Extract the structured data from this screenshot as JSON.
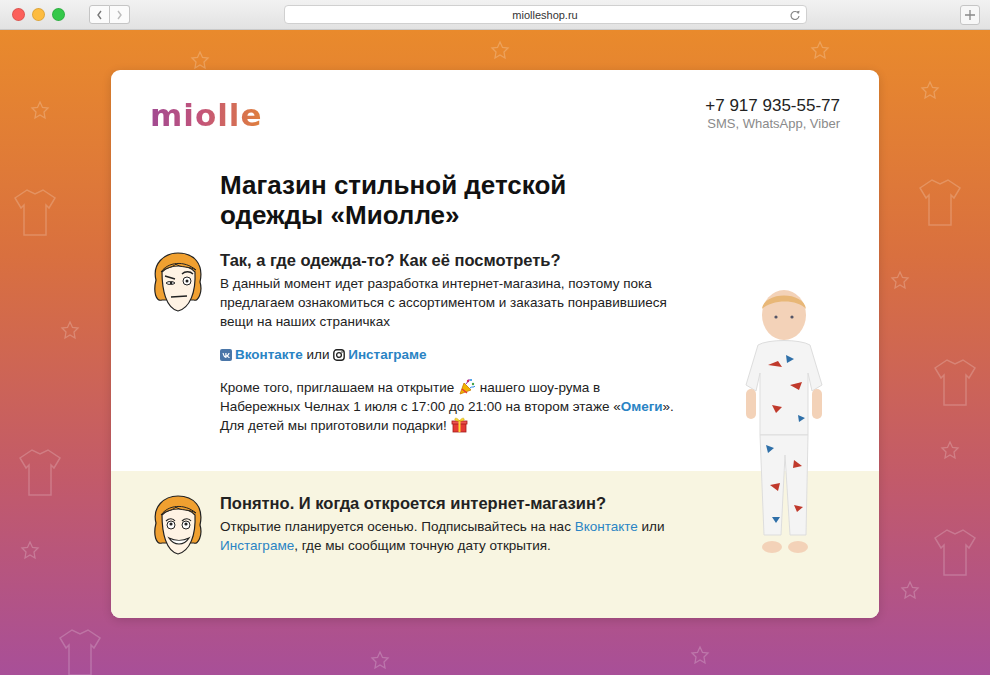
{
  "browser": {
    "url": "miolleshop.ru"
  },
  "header": {
    "logo": "miolle",
    "phone": "+7 917 935-55-77",
    "channels": "SMS, WhatsApp, Viber"
  },
  "title": "Магазин стильной детской одежды «Миолле»",
  "faq": [
    {
      "kind": "skeptical",
      "question": "Так, а где одежда-то? Как её посмотреть?",
      "paragraphs": [
        [
          {
            "kind": "text",
            "text": "В данный момент идет разработка интернет-магазина, поэтому пока предлагаем ознакомиться с ассортиментом и заказать понравившиеся вещи на наших страничках"
          }
        ],
        [
          {
            "kind": "vk",
            "text": "Вконтакте"
          },
          {
            "kind": "text",
            "text": " или "
          },
          {
            "kind": "instagram",
            "text": "Инстаграме"
          }
        ],
        [
          {
            "kind": "text",
            "text": "Кроме того, приглашаем на открытие "
          },
          {
            "kind": "party"
          },
          {
            "kind": "text",
            "text": " нашего шоу-рума в Набережных Челнах 1 июля с 17:00 до 21:00 на втором этаже «"
          },
          {
            "kind": "bold-link",
            "text": "Омеги"
          },
          {
            "kind": "text",
            "text": "». Для детей мы приготовили подарки! "
          },
          {
            "kind": "gift"
          }
        ]
      ]
    },
    {
      "kind": "happy",
      "question": "Понятно. И когда откроется интернет-магазин?",
      "paragraphs": [
        [
          {
            "kind": "text",
            "text": "Открытие планируется осенью. Подписывайтесь на нас "
          },
          {
            "kind": "link",
            "text": "Вконтакте"
          },
          {
            "kind": "text",
            "text": " или "
          },
          {
            "kind": "link",
            "text": "Инстаграме"
          },
          {
            "kind": "text",
            "text": ", где мы сообщим точную дату открытия."
          }
        ]
      ]
    }
  ]
}
